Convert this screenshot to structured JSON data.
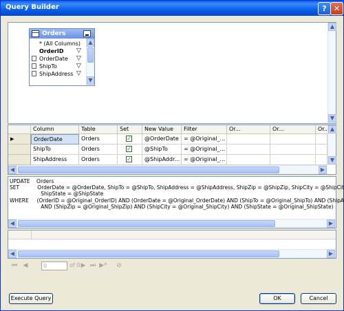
{
  "window": {
    "title": "Query Builder",
    "help_label": "?",
    "close_label": "✕"
  },
  "diagram": {
    "table_title": "Orders",
    "columns": [
      {
        "label": "* (All Columns)",
        "bold": false,
        "checked": false
      },
      {
        "label": "OrderID",
        "bold": true,
        "checked": false,
        "filter": true
      },
      {
        "label": "OrderDate",
        "bold": false,
        "checked": true,
        "filter": true
      },
      {
        "label": "ShipTo",
        "bold": false,
        "checked": true,
        "filter": true
      },
      {
        "label": "ShipAddress",
        "bold": false,
        "checked": true,
        "filter": true
      }
    ]
  },
  "grid": {
    "headers": [
      "Column",
      "Table",
      "Set",
      "New Value",
      "Filter",
      "Or...",
      "Or...",
      "Or..."
    ],
    "rows": [
      {
        "column": "OrderDate",
        "table": "Orders",
        "set": true,
        "new_value": "@OrderDate",
        "filter": "= @Original_..."
      },
      {
        "column": "ShipTo",
        "table": "Orders",
        "set": true,
        "new_value": "@ShipTo",
        "filter": "= @Original_..."
      },
      {
        "column": "ShipAddress",
        "table": "Orders",
        "set": true,
        "new_value": "@ShipAddr...",
        "filter": "= @Original_..."
      }
    ]
  },
  "sql": {
    "lines": [
      "UPDATE    Orders",
      "SET           OrderDate = @OrderDate, ShipTo = @ShipTo, ShipAddress = @ShipAddress, ShipZip = @ShipZip, ShipCity = @ShipCity,",
      "                   ShipState = @ShipState",
      "WHERE     (OrderID = @Original_OrderID) AND (OrderDate = @Original_OrderDate) AND (ShipTo = @Original_ShipTo) AND (ShipAddress",
      "                   AND (ShipZip = @Original_ShipZip) AND (ShipCity = @Original_ShipCity) AND (ShipState = @Original_ShipState)"
    ]
  },
  "navigator": {
    "position_value": "0",
    "of_text": "of 0"
  },
  "buttons": {
    "execute": "Execute Query",
    "ok": "OK",
    "cancel": "Cancel"
  }
}
